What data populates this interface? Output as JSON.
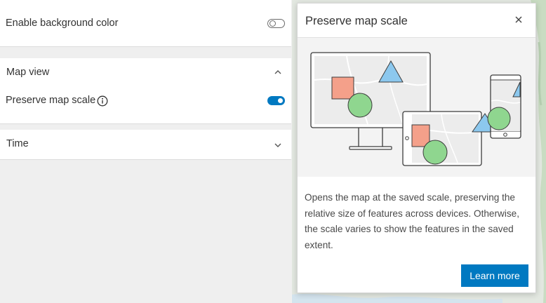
{
  "settings": {
    "background": {
      "label": "Enable background color",
      "enabled": false
    },
    "map_view": {
      "header": "Map view",
      "expanded": true,
      "preserve_label": "Preserve map scale",
      "preserve_enabled": true
    },
    "time": {
      "header": "Time",
      "expanded": false
    }
  },
  "popover": {
    "title": "Preserve map scale",
    "description": "Opens the map at the saved scale, preserving the relative size of features across devices. Otherwise, the scale varies to show the features in the saved extent.",
    "learn_more": "Learn more"
  },
  "colors": {
    "accent": "#0079c1",
    "square": "#f4a08a",
    "circle": "#8fd68f",
    "triangle": "#8cc8ee"
  },
  "icons": [
    "chevron-up-icon",
    "chevron-down-icon",
    "info-icon",
    "close-icon"
  ]
}
